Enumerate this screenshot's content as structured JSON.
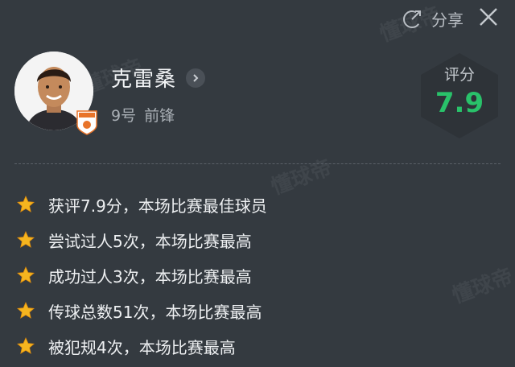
{
  "header": {
    "share_label": "分享"
  },
  "player": {
    "name": "克雷桑",
    "number": "9号",
    "position": "前锋"
  },
  "rating": {
    "label": "评分",
    "value": "7.9",
    "color": "#29c26a"
  },
  "highlights": [
    {
      "icon": "star-icon",
      "text": "获评7.9分，本场比赛最佳球员"
    },
    {
      "icon": "star-icon",
      "text": "尝试过人5次，本场比赛最高"
    },
    {
      "icon": "star-icon",
      "text": "成功过人3次，本场比赛最高"
    },
    {
      "icon": "star-icon",
      "text": "传球总数51次，本场比赛最高"
    },
    {
      "icon": "star-icon",
      "text": "被犯规4次，本场比赛最高"
    }
  ],
  "watermark": "懂球帝"
}
